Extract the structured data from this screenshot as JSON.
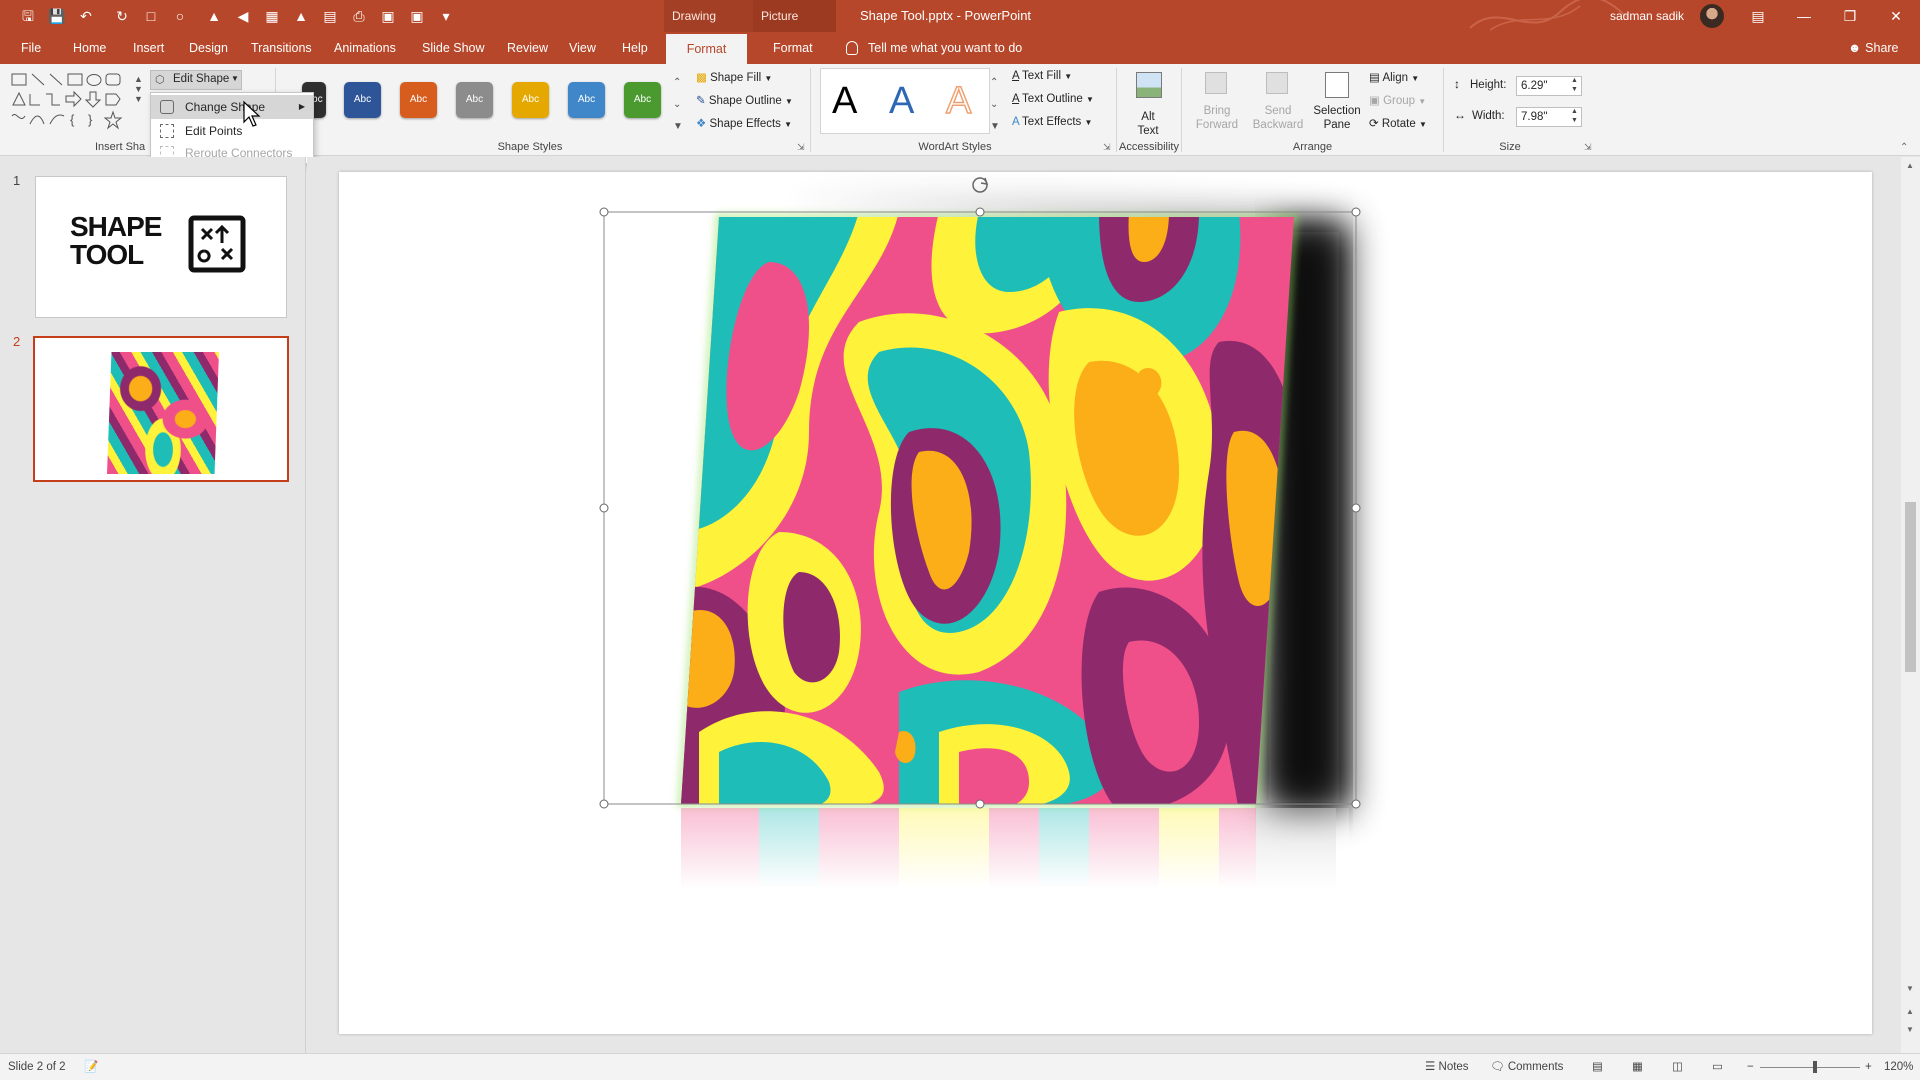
{
  "titlebar": {
    "contextual_tabs": [
      "Drawing Tools",
      "Picture Tools"
    ],
    "document_title": "Shape Tool.pptx  -  PowerPoint",
    "user_name": "sadman sadik",
    "window_buttons": [
      "ribbon-display-icon",
      "minimize-icon",
      "restore-icon",
      "close-icon"
    ]
  },
  "tabs": [
    "File",
    "Home",
    "Insert",
    "Design",
    "Transitions",
    "Animations",
    "Slide Show",
    "Review",
    "View",
    "Help",
    "Format",
    "Format"
  ],
  "active_tab_index": 10,
  "tell_me": "Tell me what you want to do",
  "share": "Share",
  "ribbon": {
    "insert_shapes": {
      "label": "Insert Sha",
      "edit_shape": "Edit Shape"
    },
    "shape_styles": {
      "label": "Shape Styles",
      "swatch_text": "Abc",
      "swatch_colors": [
        "#2f2f2f",
        "#2e5597",
        "#d65d1e",
        "#8c8c8c",
        "#e5a800",
        "#3f87c8",
        "#4a9a2f"
      ],
      "shape_fill": "Shape Fill",
      "shape_outline": "Shape Outline",
      "shape_effects": "Shape Effects"
    },
    "wordart_styles": {
      "label": "WordArt Styles",
      "letter": "A",
      "letter_colors": [
        "#000000",
        "#2e67b5",
        "#f0a070"
      ],
      "text_fill": "Text Fill",
      "text_outline": "Text Outline",
      "text_effects": "Text Effects"
    },
    "accessibility": {
      "label": "Accessibility",
      "alt_text": "Alt Text"
    },
    "arrange": {
      "label": "Arrange",
      "bring_forward": "Bring Forward",
      "send_backward": "Send Backward",
      "selection_pane": "Selection Pane",
      "align": "Align",
      "group": "Group",
      "rotate": "Rotate"
    },
    "size": {
      "label": "Size",
      "height_label": "Height:",
      "height_value": "6.29\"",
      "width_label": "Width:",
      "width_value": "7.98\""
    }
  },
  "edit_shape_menu": {
    "items": [
      {
        "label": "Change Shape",
        "state": "hover",
        "has_submenu": true
      },
      {
        "label": "Edit Points",
        "state": "normal"
      },
      {
        "label": "Reroute Connectors",
        "state": "disabled"
      }
    ]
  },
  "thumbnails": [
    {
      "number": "1",
      "title_line1": "SHAPE",
      "title_line2": "TOOL",
      "selected": false
    },
    {
      "number": "2",
      "selected": true
    }
  ],
  "statusbar": {
    "slide_info": "Slide 2 of 2",
    "notes": "Notes",
    "comments": "Comments",
    "zoom": "120%",
    "zoom_level": 0.55
  },
  "colors": {
    "accent": "#b7472a",
    "pattern_pink": "#f0508a",
    "pattern_teal": "#1ebdb8",
    "pattern_yellow": "#fff23a",
    "pattern_orange": "#fbae17",
    "pattern_purple": "#8e2a6b"
  }
}
